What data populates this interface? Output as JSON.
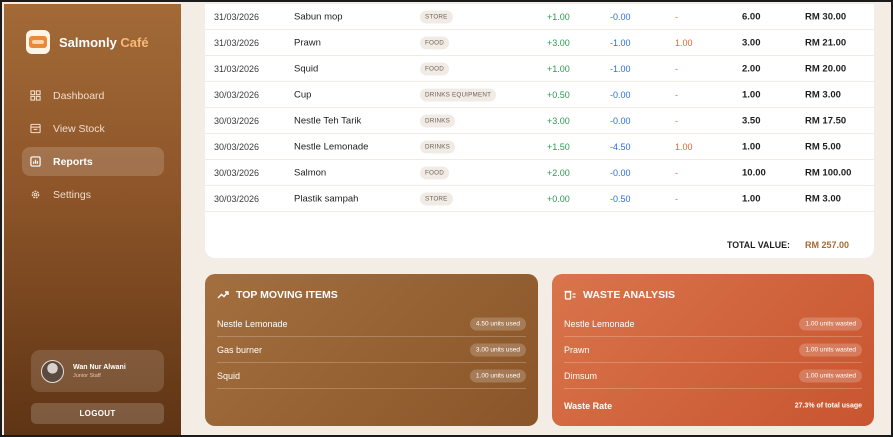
{
  "brand": {
    "name": "Salmonly",
    "accent": "Café"
  },
  "nav": [
    {
      "label": "Dashboard",
      "icon": "dashboard-icon",
      "active": false
    },
    {
      "label": "View Stock",
      "icon": "stock-icon",
      "active": false
    },
    {
      "label": "Reports",
      "icon": "reports-icon",
      "active": true
    },
    {
      "label": "Settings",
      "icon": "settings-icon",
      "active": false
    }
  ],
  "user": {
    "name": "Wan Nur Alwani",
    "role": "Junior Staff"
  },
  "logout_label": "LOGOUT",
  "table": {
    "rows": [
      {
        "date": "31/03/2026",
        "item": "Sabun mop",
        "category": "STORE",
        "in": "+1.00",
        "out": "-0.00",
        "waste": "-",
        "balance": "6.00",
        "value": "RM 30.00"
      },
      {
        "date": "31/03/2026",
        "item": "Prawn",
        "category": "FOOD",
        "in": "+3.00",
        "out": "-1.00",
        "waste": "1.00",
        "balance": "3.00",
        "value": "RM 21.00"
      },
      {
        "date": "31/03/2026",
        "item": "Squid",
        "category": "FOOD",
        "in": "+1.00",
        "out": "-1.00",
        "waste": "-",
        "balance": "2.00",
        "value": "RM 20.00"
      },
      {
        "date": "30/03/2026",
        "item": "Cup",
        "category": "DRINKS EQUIPMENT",
        "in": "+0.50",
        "out": "-0.00",
        "waste": "-",
        "balance": "1.00",
        "value": "RM 3.00"
      },
      {
        "date": "30/03/2026",
        "item": "Nestle Teh Tarik",
        "category": "DRINKS",
        "in": "+3.00",
        "out": "-0.00",
        "waste": "-",
        "balance": "3.50",
        "value": "RM 17.50"
      },
      {
        "date": "30/03/2026",
        "item": "Nestle Lemonade",
        "category": "DRINKS",
        "in": "+1.50",
        "out": "-4.50",
        "waste": "1.00",
        "balance": "1.00",
        "value": "RM 5.00"
      },
      {
        "date": "30/03/2026",
        "item": "Salmon",
        "category": "FOOD",
        "in": "+2.00",
        "out": "-0.00",
        "waste": "-",
        "balance": "10.00",
        "value": "RM 100.00"
      },
      {
        "date": "30/03/2026",
        "item": "Plastik sampah",
        "category": "STORE",
        "in": "+0.00",
        "out": "-0.50",
        "waste": "-",
        "balance": "1.00",
        "value": "RM 3.00"
      }
    ],
    "total_label": "TOTAL VALUE:",
    "total_value": "RM 257.00"
  },
  "top_moving": {
    "title": "TOP MOVING ITEMS",
    "items": [
      {
        "name": "Nestle Lemonade",
        "usage": "4.50 units used"
      },
      {
        "name": "Gas burner",
        "usage": "3.00 units used"
      },
      {
        "name": "Squid",
        "usage": "1.00 units used"
      }
    ]
  },
  "waste_analysis": {
    "title": "WASTE ANALYSIS",
    "items": [
      {
        "name": "Nestle Lemonade",
        "waste": "1.00 units wasted"
      },
      {
        "name": "Prawn",
        "waste": "1.00 units wasted"
      },
      {
        "name": "Dimsum",
        "waste": "1.00 units wasted"
      }
    ],
    "rate_label": "Waste Rate",
    "rate_value": "27.3% of total usage"
  },
  "colors": {
    "in": "#2e9a4e",
    "out": "#2a6fd8",
    "waste": "#d9663a",
    "accent": "#a66b2d"
  }
}
